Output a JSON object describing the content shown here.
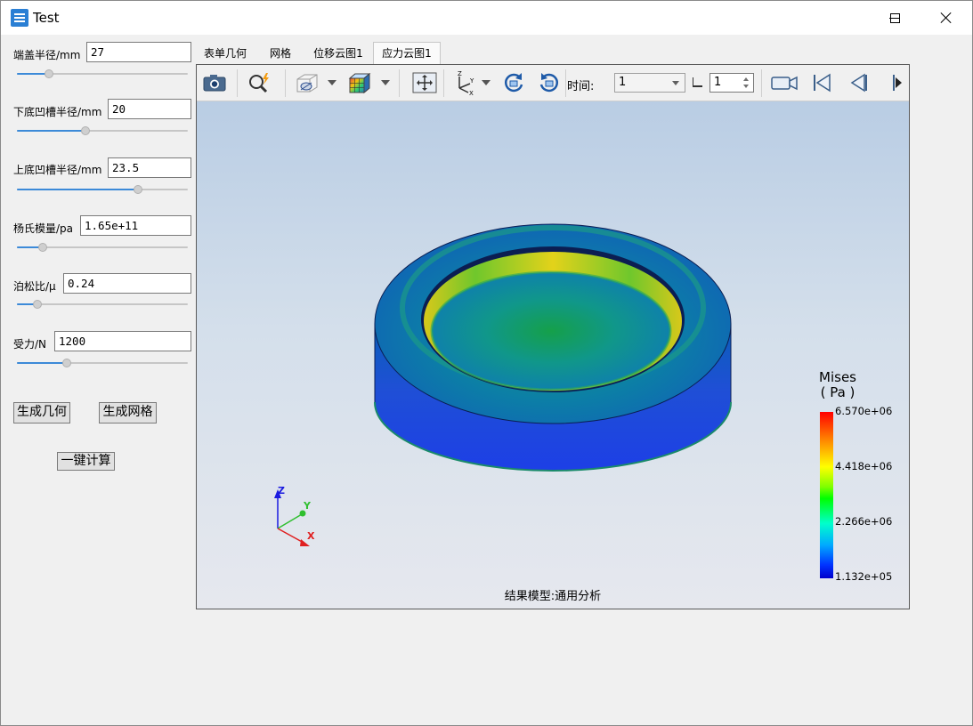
{
  "window": {
    "title": "Test",
    "brand_color": "#2a7fd4"
  },
  "params": [
    {
      "label": "端盖半径/mm",
      "value": "27",
      "slider_fraction": 0.19
    },
    {
      "label": "下底凹槽半径/mm",
      "value": "20",
      "slider_fraction": 0.4
    },
    {
      "label": "上底凹槽半径/mm",
      "value": "23.5",
      "slider_fraction": 0.71
    },
    {
      "label": "杨氏模量/pa",
      "value": "1.65e+11",
      "slider_fraction": 0.15
    },
    {
      "label": "泊松比/μ",
      "value": "0.24",
      "slider_fraction": 0.12
    },
    {
      "label": "受力/N",
      "value": "1200",
      "slider_fraction": 0.29
    }
  ],
  "buttons": {
    "gen_geometry": "生成几何",
    "gen_mesh": "生成网格",
    "compute": "一键计算"
  },
  "tabs": [
    {
      "label": "表单几何",
      "active": false
    },
    {
      "label": "网格",
      "active": false
    },
    {
      "label": "位移云图1",
      "active": false
    },
    {
      "label": "应力云图1",
      "active": true
    }
  ],
  "toolbar": {
    "icons": [
      "camera-icon",
      "zoom-icon",
      "display-mode-icon",
      "color-cube-icon",
      "fit-view-icon",
      "axes-view-icon",
      "rotate-cw-icon",
      "rotate-ccw-icon",
      "video-record-icon",
      "first-frame-icon",
      "previous-frame-icon",
      "next-frame-icon"
    ],
    "time_label": "时间:",
    "time_value": "1",
    "step_value": "1"
  },
  "viewport": {
    "axis_labels": {
      "x": "X",
      "y": "Y",
      "z": "Z"
    },
    "legend": {
      "title": "Mises",
      "unit": "( Pa )",
      "ticks": [
        "6.570e+06",
        "4.418e+06",
        "2.266e+06",
        "1.132e+05"
      ]
    },
    "footer": "结果模型:通用分析"
  }
}
